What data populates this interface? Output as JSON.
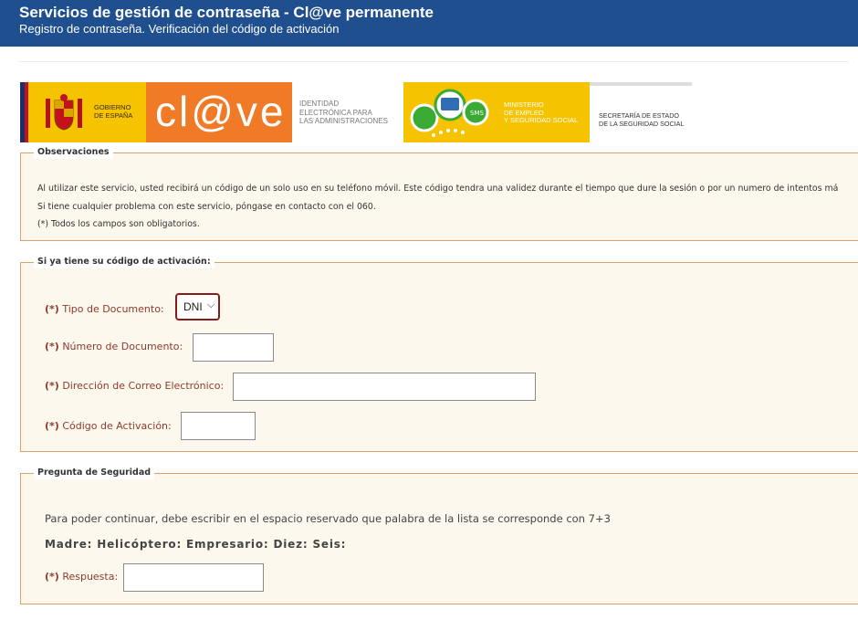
{
  "header": {
    "title": "Servicios de gestión de contraseña - Cl@ve permanente",
    "subtitle": "Registro de contraseña. Verificación del código de activación"
  },
  "banner": {
    "gobierno": [
      "GOBIERNO",
      "DE ESPAÑA"
    ],
    "clave_logo": "cl@ve",
    "identidad": [
      "IDENTIDAD",
      "ELECTRÓNICA PARA",
      "LAS ADMINISTRACIONES"
    ],
    "ministerio": [
      "MINISTERIO",
      "DE EMPLEO",
      "Y SEGURIDAD SOCIAL"
    ],
    "secretaria": [
      "SECRETARÍA DE ESTADO",
      "DE LA SEGURIDAD SOCIAL"
    ],
    "sms_label": "SMS"
  },
  "observaciones": {
    "legend": "Observaciones",
    "lines": [
      "Al utilizar este servicio, usted recibirá un código de un solo uso en su teléfono móvil. Este código tendra una validez durante el tiempo que dure la sesión o por un numero de intentos má",
      "Si tiene cualquier problema con este servicio, póngase en contacto con el 060.",
      "(*) Todos los campos son obligatorios."
    ]
  },
  "codigo": {
    "legend": "Si ya tiene su código de activación:",
    "required_mark": "(*)",
    "tipo_label": "Tipo de Documento:",
    "tipo_value": "DNI",
    "numero_label": "Número de Documento:",
    "correo_label": "Dirección de Correo Electrónico:",
    "activacion_label": "Código de Activación:"
  },
  "pregunta": {
    "legend": "Pregunta de Seguridad",
    "question": "Para poder continuar, debe escribir en el espacio reservado que palabra de la lista se corresponde con 7+3",
    "words": "Madre: Helicóptero: Empresario: Diez: Seis:",
    "required_mark": "(*)",
    "respuesta_label": "Respuesta:"
  },
  "colors": {
    "header_bg": "#1f4f8f",
    "fieldset_border": "#d9a36b",
    "fieldset_bg": "#fdf8ee",
    "label_color": "#8a3b2c",
    "clave_orange": "#f07a26",
    "gov_yellow": "#f6c300"
  }
}
